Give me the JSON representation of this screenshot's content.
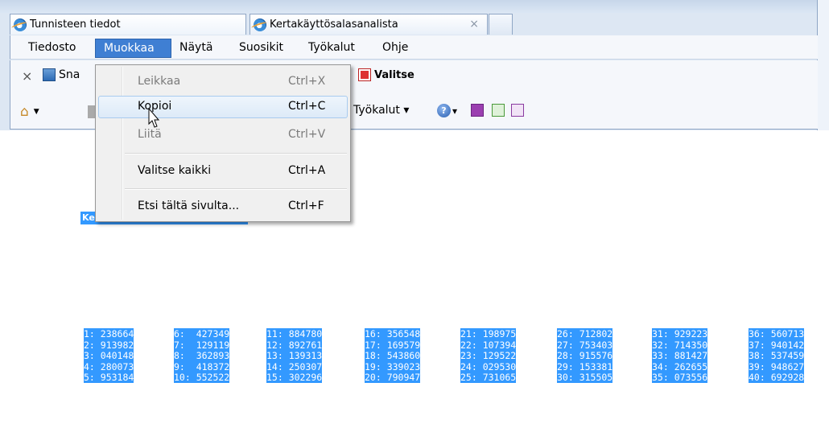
{
  "tabs": [
    {
      "title": "Tunnisteen tiedot"
    },
    {
      "title": "Kertakäyttösalasanalista",
      "close": "×"
    }
  ],
  "menubar": [
    "Tiedosto",
    "Muokkaa",
    "Näytä",
    "Suosikit",
    "Työkalut",
    "Ohje"
  ],
  "menubar_active": "Muokkaa",
  "toolbar1": {
    "close": "×",
    "snap": "Sna",
    "select": "Valitse"
  },
  "toolbar2": {
    "tools": "Työkalut ▾",
    "help_arrow": "▾"
  },
  "edit_menu": {
    "items": [
      {
        "label": "Leikkaa",
        "shortcut": "Ctrl+X",
        "enabled": false
      },
      {
        "label": "Kopioi",
        "shortcut": "Ctrl+C",
        "enabled": true,
        "hover": true
      },
      {
        "label": "Liitä",
        "shortcut": "Ctrl+V",
        "enabled": false
      },
      {
        "label": "Valitse kaikki",
        "shortcut": "Ctrl+A",
        "enabled": true
      },
      {
        "label": "Etsi tältä sivulta...",
        "shortcut": "Ctrl+F",
        "enabled": true
      }
    ]
  },
  "page": {
    "heading_fragment": "Ke",
    "code_columns": [
      [
        "1: 238664",
        "2: 913982",
        "3: 040148",
        "4: 280073",
        "5: 953184"
      ],
      [
        "6:  427349",
        "7:  129119",
        "8:  362893",
        "9:  418372",
        "10: 552522"
      ],
      [
        "11: 884780",
        "12: 892761",
        "13: 139313",
        "14: 250307",
        "15: 302296"
      ],
      [
        "16: 356548",
        "17: 169579",
        "18: 543860",
        "19: 339023",
        "20: 790947"
      ],
      [
        "21: 198975",
        "22: 107394",
        "23: 129522",
        "24: 029530",
        "25: 731065"
      ],
      [
        "26: 712802",
        "27: 753403",
        "28: 915576",
        "29: 153381",
        "30: 315505"
      ],
      [
        "31: 929223",
        "32: 714350",
        "33: 881427",
        "34: 262655",
        "35: 073556"
      ],
      [
        "36: 560713",
        "37: 940142",
        "38: 537459",
        "39: 948627",
        "40: 692928"
      ]
    ]
  },
  "colors": {
    "selection": "#3399ff",
    "menu_active": "#3f7fd3",
    "chrome": "#dde7f3"
  }
}
